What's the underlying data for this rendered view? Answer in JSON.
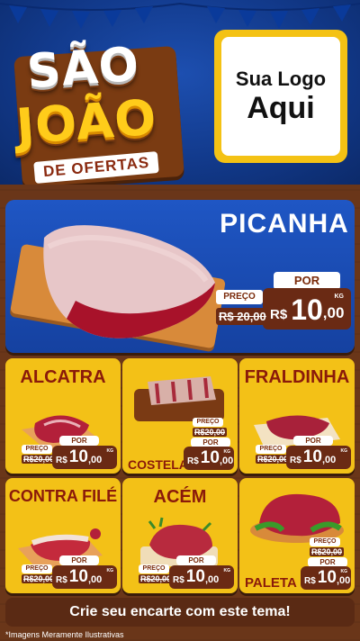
{
  "header": {
    "title_line1": "SÃO",
    "title_line2": "JOÃO",
    "title_line3": "DE OFERTAS",
    "logo_line1": "Sua Logo",
    "logo_line2": "Aqui"
  },
  "hero": {
    "name": "PICANHA",
    "por_label": "POR",
    "preco_label": "PREÇO",
    "old_price": "R$ 20,00",
    "currency": "R$",
    "price_int": "10",
    "price_dec": ",00",
    "unit": "KG"
  },
  "products": [
    {
      "name": "ALCATRA",
      "preco_label": "PREÇO",
      "old_price": "R$20,00",
      "por_label": "POR",
      "currency": "R$",
      "price_int": "10",
      "price_dec": ",00",
      "unit": "KG"
    },
    {
      "name": "COSTELA",
      "preco_label": "PREÇO",
      "old_price": "R$20,00",
      "por_label": "POR",
      "currency": "R$",
      "price_int": "10",
      "price_dec": ",00",
      "unit": "KG"
    },
    {
      "name": "FRALDINHA",
      "preco_label": "PREÇO",
      "old_price": "R$20,00",
      "por_label": "POR",
      "currency": "R$",
      "price_int": "10",
      "price_dec": ",00",
      "unit": "KG"
    },
    {
      "name": "CONTRA FILÉ",
      "preco_label": "PREÇO",
      "old_price": "R$20,00",
      "por_label": "POR",
      "currency": "R$",
      "price_int": "10",
      "price_dec": ",00",
      "unit": "KG"
    },
    {
      "name": "ACÉM",
      "preco_label": "PREÇO",
      "old_price": "R$20,00",
      "por_label": "POR",
      "currency": "R$",
      "price_int": "10",
      "price_dec": ",00",
      "unit": "KG"
    },
    {
      "name": "PALETA",
      "preco_label": "PREÇO",
      "old_price": "R$20,00",
      "por_label": "POR",
      "currency": "R$",
      "price_int": "10",
      "price_dec": ",00",
      "unit": "KG"
    }
  ],
  "cta": "Crie seu encarte com este tema!",
  "disclaimer": "*Imagens Meramente Ilustrativas",
  "colors": {
    "blue": "#1f56c4",
    "yellow": "#f3c117",
    "brown": "#6a2a14",
    "title_red": "#8a1a0a"
  }
}
